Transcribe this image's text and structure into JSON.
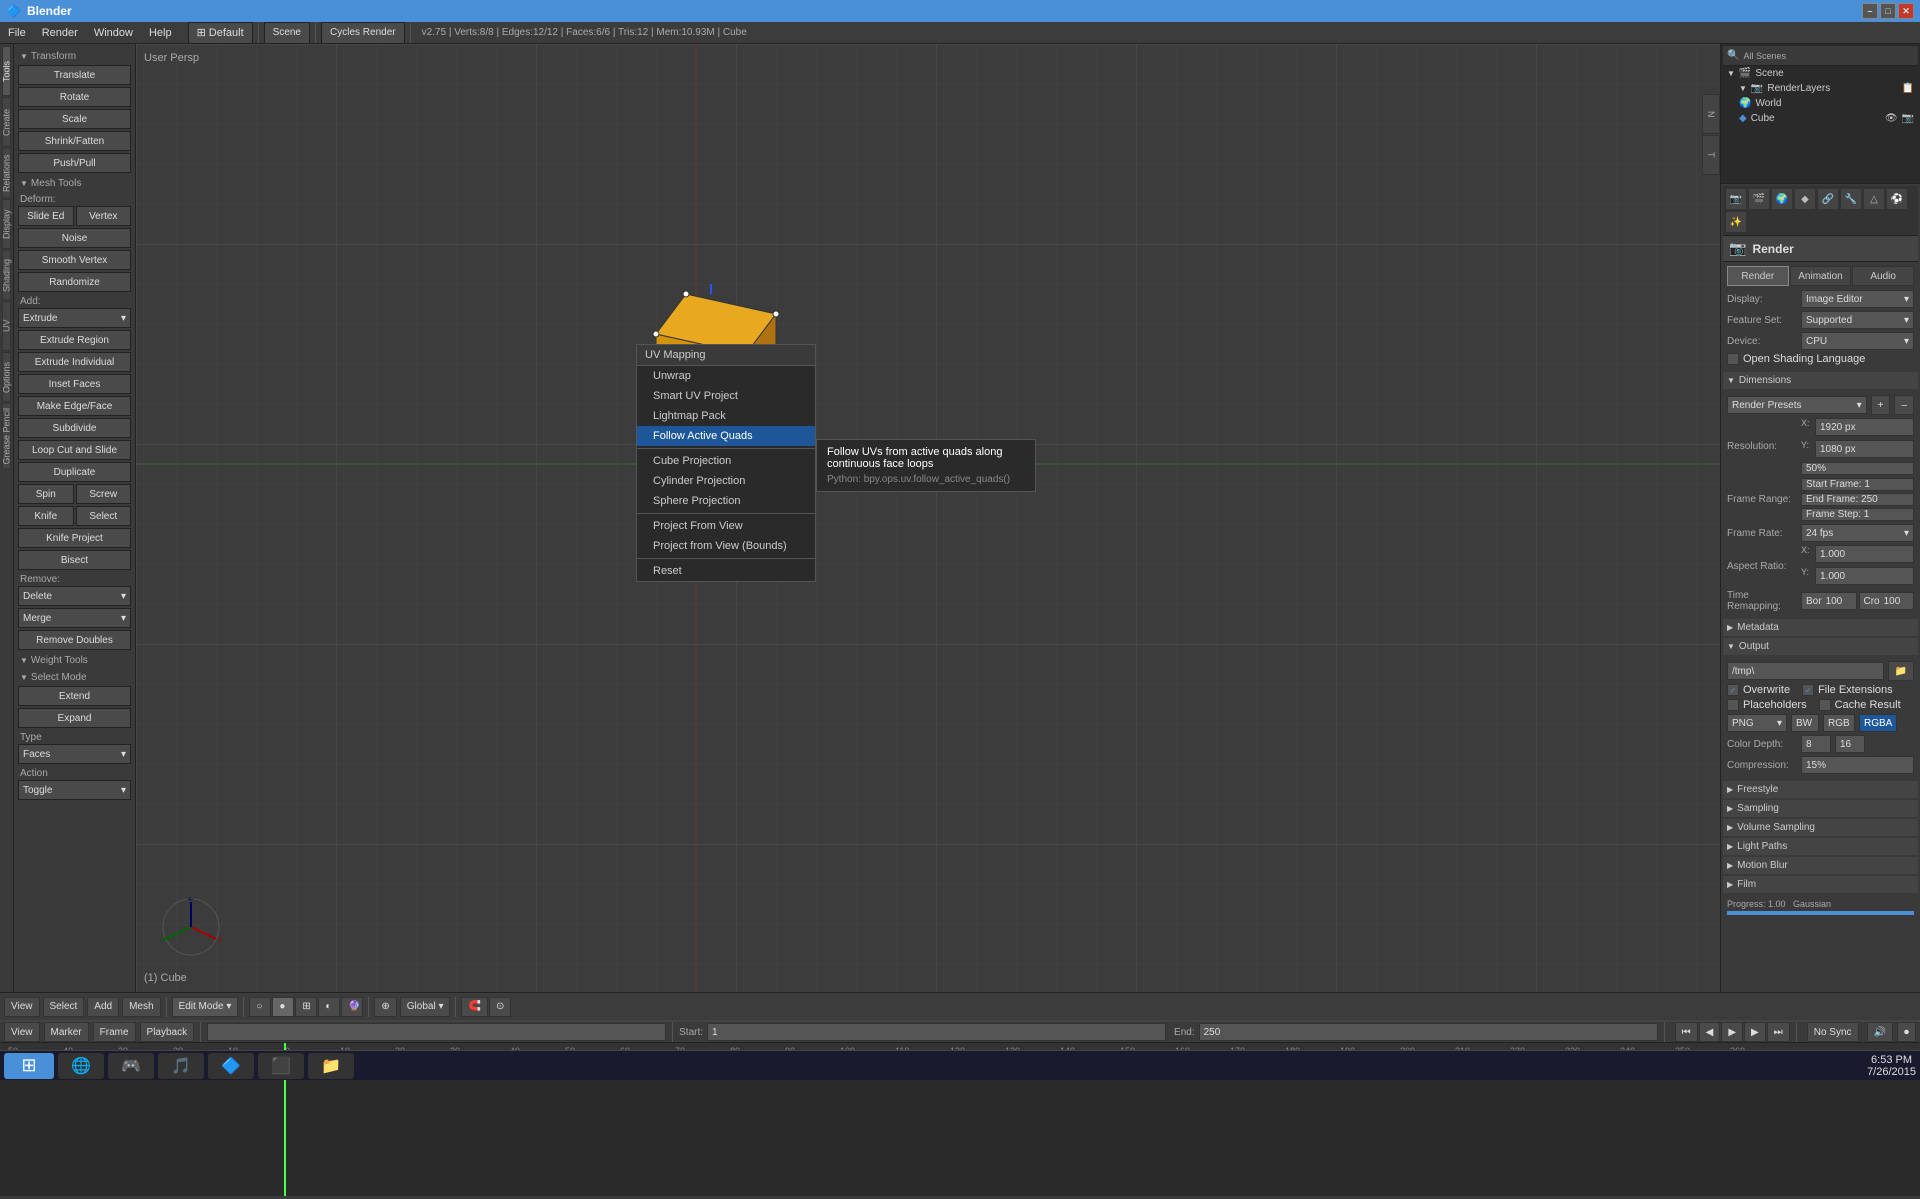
{
  "titleBar": {
    "title": "Blender",
    "minimize": "–",
    "maximize": "□",
    "close": "✕"
  },
  "menuBar": {
    "items": [
      "File",
      "Render",
      "Window",
      "Help"
    ]
  },
  "toolbar": {
    "layout": "Default",
    "scene": "Scene",
    "renderer": "Cycles Render",
    "info": "v2.75 | Verts:8/8 | Edges:12/12 | Faces:6/6 | Tris:12 | Mem:10.93M | Cube"
  },
  "leftPanel": {
    "transform": {
      "title": "Transform",
      "buttons": [
        "Translate",
        "Rotate",
        "Scale",
        "Shrink/Fatten",
        "Push/Pull"
      ]
    },
    "meshTools": {
      "title": "Mesh Tools",
      "deform": "Deform:",
      "slideEdVertex": [
        "Slide Ed",
        "Vertex"
      ],
      "noise": "Noise",
      "smoothVertex": "Smooth Vertex",
      "randomize": "Randomize",
      "add": "Add:",
      "extrude": "Extrude",
      "extrudeRegion": "Extrude Region",
      "extrudeIndividual": "Extrude Individual",
      "insetFaces": "Inset Faces",
      "makeEdgeFace": "Make Edge/Face",
      "subdivide": "Subdivide",
      "loopCutAndSlide": "Loop Cut and Slide",
      "duplicate": "Duplicate",
      "spinScrew": [
        "Spin",
        "Screw"
      ],
      "knifeSelect": [
        "Knife",
        "Select"
      ],
      "knifeProject": "Knife Project",
      "bisect": "Bisect",
      "remove": "Remove:",
      "delete": "Delete",
      "merge": "Merge",
      "removeDoubles": "Remove Doubles"
    },
    "weightTools": {
      "title": "Weight Tools"
    },
    "selectMode": {
      "title": "Select Mode",
      "extend": "Extend",
      "expand": "Expand",
      "type": "Type",
      "faces": "Faces",
      "action": "Action",
      "toggle": "Toggle"
    }
  },
  "viewport": {
    "label": "User Persp",
    "bottomLabel": "(1) Cube"
  },
  "uvMappingMenu": {
    "title": "UV Mapping",
    "items": [
      "Unwrap",
      "Smart UV Project",
      "Lightmap Pack",
      "Follow Active Quads",
      "Cube Projection",
      "Cylinder Projection",
      "Sphere Projection",
      "Project From View",
      "Project from View (Bounds)",
      "Reset"
    ],
    "activeItem": "Follow Active Quads"
  },
  "tooltip": {
    "title": "Follow UVs from active quads along continuous face loops",
    "python": "Python: bpy.ops.uv.follow_active_quads()"
  },
  "rightPanel": {
    "outliner": {
      "items": [
        {
          "label": "Scene",
          "indent": 0,
          "icon": "🎬"
        },
        {
          "label": "RenderLayers",
          "indent": 1,
          "icon": "📷"
        },
        {
          "label": "World",
          "indent": 1,
          "icon": "🌍"
        },
        {
          "label": "Cube",
          "indent": 1,
          "icon": "🔷"
        }
      ]
    },
    "properties": {
      "render": {
        "title": "Render",
        "display": "Display:",
        "displayValue": "Image Editor",
        "featureSet": "Feature Set:",
        "featureSetValue": "Supported",
        "device": "Device:",
        "deviceValue": "CPU",
        "openShadingLanguage": "Open Shading Language",
        "dimensions": "Dimensions",
        "renderPresets": "Render Presets",
        "resolution": "Resolution:",
        "x": "X:",
        "xValue": "1920 px",
        "y": "Y:",
        "yValue": "1080 px",
        "percent": "50%",
        "aspectRatio": "Aspect Ratio:",
        "frameRange": "Frame Range:",
        "startFrame": "Start Frame: 1",
        "endFrame": "End Frame: 250",
        "frameStep": "Frame Step: 1",
        "frameRate": "Frame Rate:",
        "fps": "24 fps",
        "aspectX": "X:",
        "aspectXValue": "1.000",
        "aspectY": "Y:",
        "aspectYValue": "1.000",
        "timeRemapping": "Time Remapping:",
        "bor": "Bor",
        "cro": "Cro",
        "borVal": "100",
        "croVal": "100",
        "metadata": "Metadata",
        "output": "Output",
        "outputPath": "/tmp\\",
        "overwrite": "Overwrite",
        "fileExtensions": "File Extensions",
        "placeholders": "Placeholders",
        "cacheResult": "Cache Result",
        "format": "PNG",
        "bw": "BW",
        "rgb": "RGB",
        "rgba": "RGBA",
        "colorDepth": "Color Depth:",
        "colorDepth8": "8",
        "colorDepth16": "16",
        "compression": "Compression:",
        "compressionValue": "15%",
        "freestyle": "Freestyle",
        "sampling": "Sampling",
        "volumeSampling": "Volume Sampling",
        "lightPaths": "Light Paths",
        "motionBlur": "Motion Blur",
        "film": "Film",
        "progress": "Progress: 1.00",
        "gaussian": "Gaussian"
      }
    }
  },
  "viewportHeader": {
    "viewMode": "Edit Mode",
    "globalLocal": "Global",
    "select": "Select",
    "add": "Add",
    "mesh": "Mesh",
    "view": "View"
  },
  "timeline": {
    "view": "View",
    "marker": "Marker",
    "frame": "Frame",
    "playback": "Playback",
    "start": "Start:",
    "startVal": "1",
    "end": "End:",
    "endVal": "250",
    "noSync": "No Sync"
  },
  "taskbar": {
    "time": "6:53 PM",
    "date": "7/26/2015"
  }
}
